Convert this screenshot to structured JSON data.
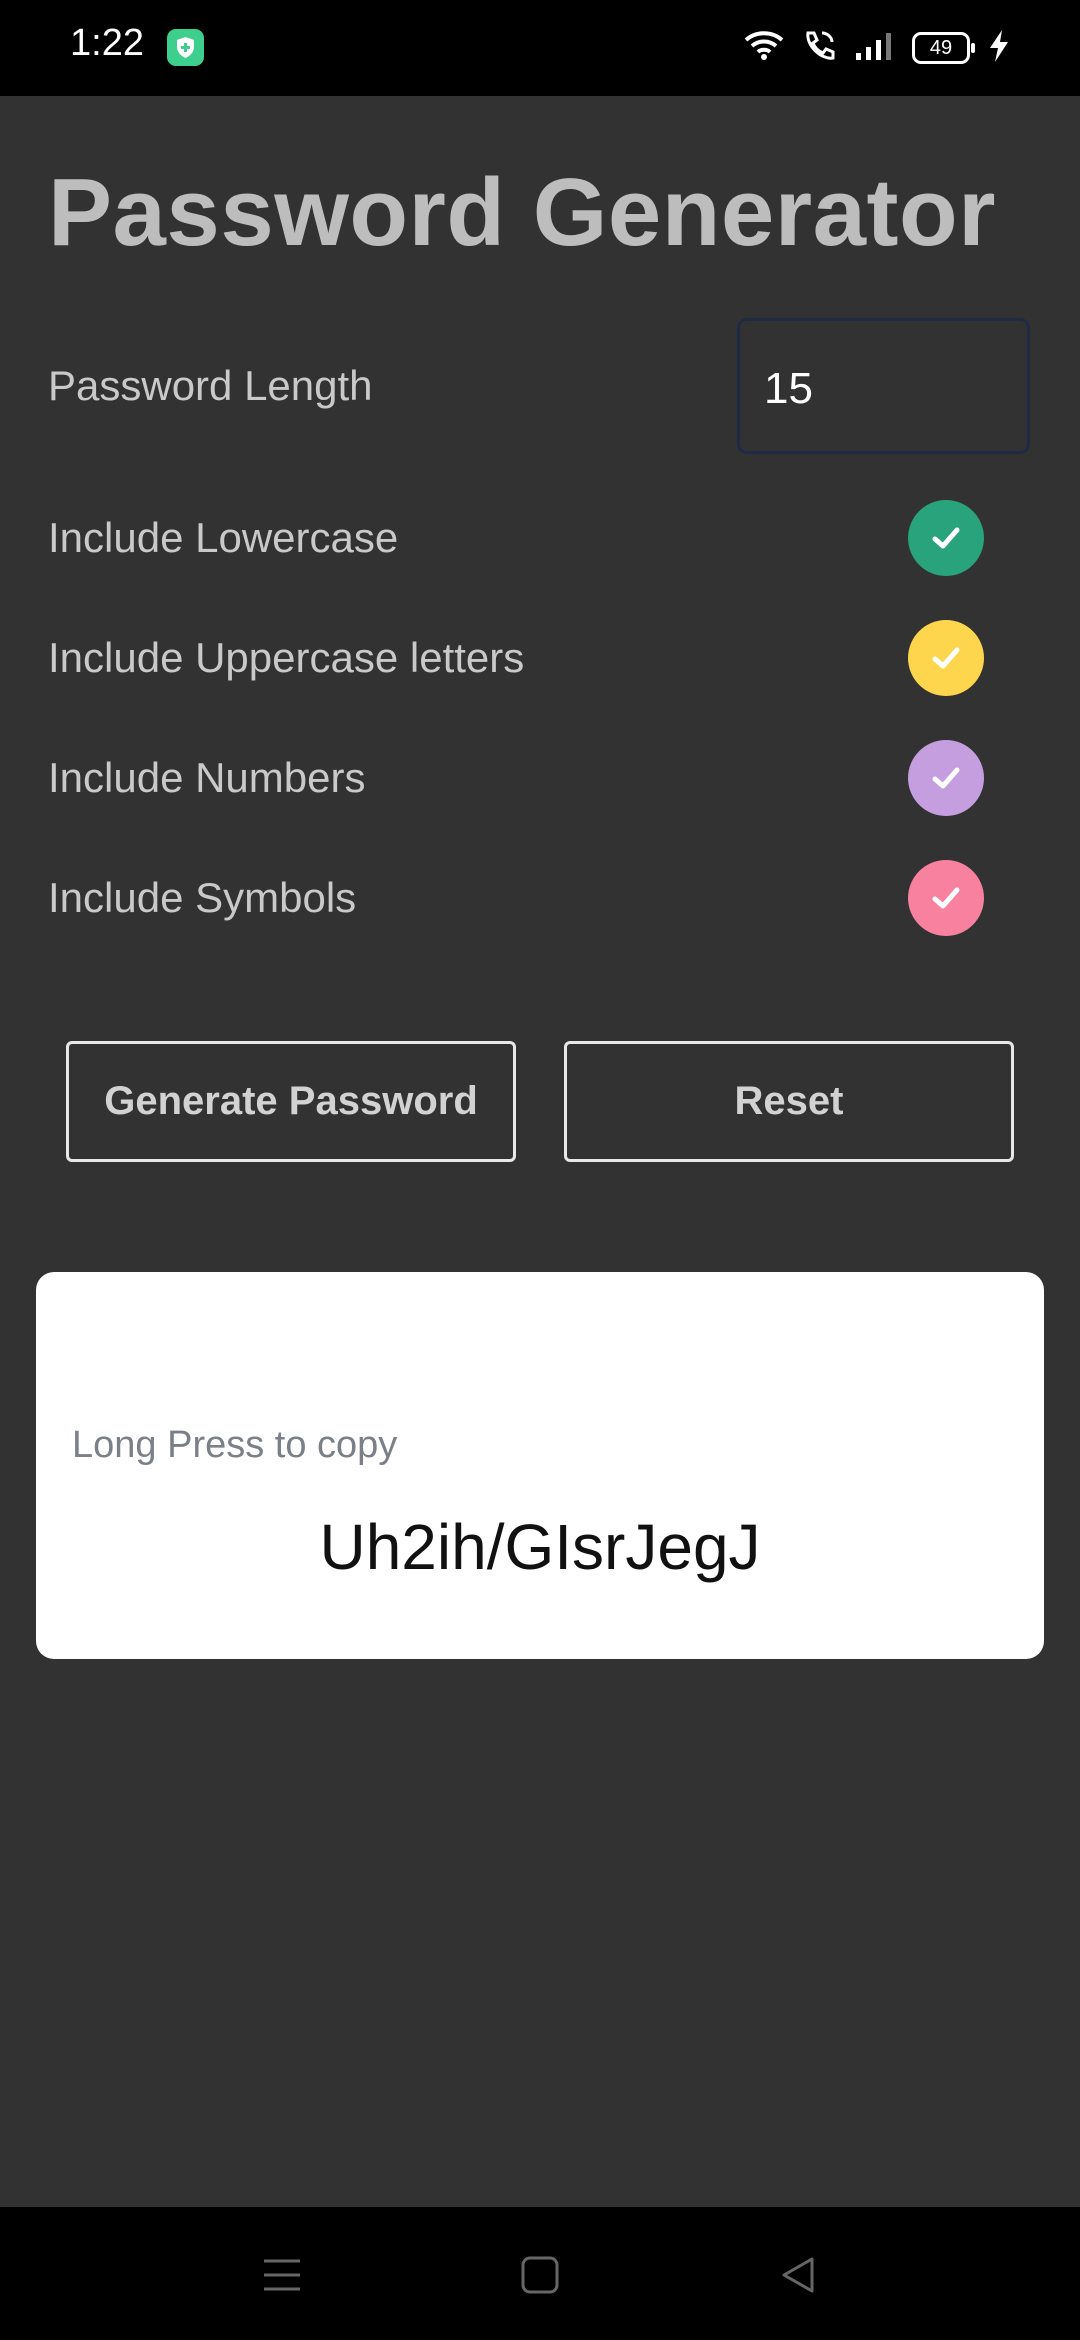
{
  "status_bar": {
    "time": "1:22",
    "battery": "49",
    "icons": [
      "shield-badge-icon",
      "wifi-icon",
      "wifi-calling-icon",
      "signal-icon",
      "battery-icon",
      "charging-bolt-icon"
    ]
  },
  "title": "Password Generator",
  "length": {
    "label": "Password Length",
    "value": "15"
  },
  "options": [
    {
      "label": "Include Lowercase",
      "checked": true,
      "color": "#29a37c"
    },
    {
      "label": "Include Uppercase letters",
      "checked": true,
      "color": "#fdd64e"
    },
    {
      "label": "Include Numbers",
      "checked": true,
      "color": "#c59ee0"
    },
    {
      "label": "Include Symbols",
      "checked": true,
      "color": "#f7819f"
    }
  ],
  "buttons": {
    "generate": "Generate Password",
    "reset": "Reset"
  },
  "result": {
    "hint": "Long Press to copy",
    "password": "Uh2ih/GIsrJegJ"
  },
  "nav": {
    "icons": [
      "menu-icon",
      "home-icon",
      "back-icon"
    ]
  }
}
